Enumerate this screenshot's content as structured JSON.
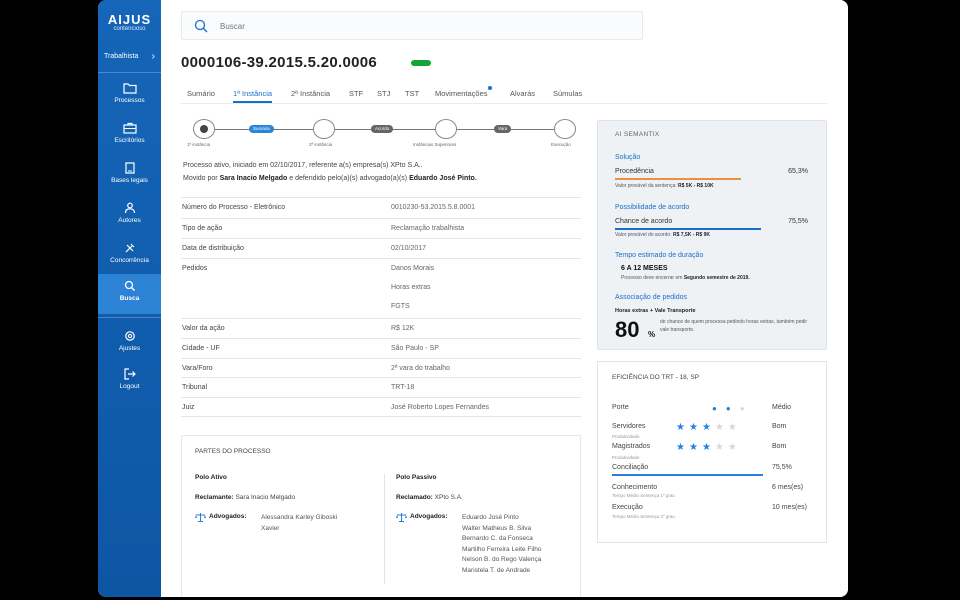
{
  "sidebar": {
    "logo_main": "AIJUS",
    "logo_sub": "contencioso",
    "area_label": "Trabalhista",
    "items": [
      {
        "label": "Processos",
        "icon": "folder-icon"
      },
      {
        "label": "Escritórios",
        "icon": "briefcase-icon"
      },
      {
        "label": "Bases legais",
        "icon": "book-icon"
      },
      {
        "label": "Autores",
        "icon": "users-icon"
      },
      {
        "label": "Concorrência",
        "icon": "tools-icon"
      },
      {
        "label": "Busca",
        "icon": "search-icon",
        "active": true
      },
      {
        "label": "Ajustes",
        "icon": "gear-icon"
      },
      {
        "label": "Logout",
        "icon": "logout-icon"
      }
    ]
  },
  "search": {
    "placeholder": "Buscar"
  },
  "process": {
    "number": "0000106-39.2015.5.20.0006",
    "tabs": [
      "Sumário",
      "1ª Instância",
      "2ª Instância",
      "STF",
      "STJ",
      "TST",
      "Movimentações",
      "Alvarás",
      "Súmulas"
    ],
    "active_tab": "1ª Instância",
    "timeline": {
      "stages": [
        "1ª instância",
        "2ª instância",
        "Instâncias Superiores",
        "Execução"
      ],
      "transitions": [
        "Sumaria",
        "Acordo",
        "Vara"
      ]
    },
    "summary": {
      "line1": "Processo ativo, iniciado em 02/10/2017, referente a(s) empresa(s) XPto S.A..",
      "line2_pre": "Movido por",
      "plaintiff": "Sara Inacio Melgado",
      "line2_mid": "e defendido pelo(a)(s) advogado(a)(s)",
      "defender": "Eduardo José Pinto."
    },
    "details": [
      {
        "label": "Número do Processo - Eletrônico",
        "values": [
          "0010230-53.2015.5.8.0001"
        ]
      },
      {
        "label": "Tipo de ação",
        "values": [
          "Reclamação trabalhista"
        ]
      },
      {
        "label": "Data de distribuição",
        "values": [
          "02/10/2017"
        ]
      },
      {
        "label": "Pedidos",
        "values": [
          "Danos Morais",
          "Horas extras",
          "FGTS"
        ]
      },
      {
        "label": "Valor da ação",
        "values": [
          "R$ 12K"
        ]
      },
      {
        "label": "Cidade - UF",
        "values": [
          "São Paulo - SP"
        ]
      },
      {
        "label": "Vara/Foro",
        "values": [
          "2ª vara do trabalho"
        ]
      },
      {
        "label": "Tribunal",
        "values": [
          "TRT-18"
        ]
      },
      {
        "label": "Juiz",
        "values": [
          "José Roberto Lopes Fernandes"
        ]
      }
    ]
  },
  "partes": {
    "title": "PARTES DO PROCESSO",
    "ativo": {
      "heading": "Polo Ativo",
      "party_label": "Reclamante:",
      "party": "Sara Inacio Melgado",
      "adv_label": "Advogados:",
      "advogados": [
        "Alessandra Karley Giboski",
        "Xavier"
      ]
    },
    "passivo": {
      "heading": "Polo Passivo",
      "party_label": "Reclamado:",
      "party": "XPto S.A.",
      "adv_label": "Advogados:",
      "advogados": [
        "Eduardo José Pinto",
        "Walter Matheus B. Silva",
        "Bernardo C. da Fonseca",
        "Martilho Ferreira Leite Filho",
        "Nelson B. do Rego Valença",
        "Maristela T. de Andrade"
      ]
    }
  },
  "semantix": {
    "title": "AI SEMANTIX",
    "solucao": {
      "heading": "Solução",
      "label": "Procedência",
      "value": "65,3%",
      "fraction": 0.653,
      "sub_pre": "Valor provável da sentença:",
      "sub_val": "R$ 5K - R$ 10K"
    },
    "acordo": {
      "heading": "Possibilidade de acordo",
      "label": "Chance de acordo",
      "value": "75,5%",
      "fraction": 0.755,
      "sub_pre": "Valor provável do acordo:",
      "sub_val": "R$ 7,5K - R$ 9K"
    },
    "duracao": {
      "heading": "Tempo estimado de duração",
      "value": "6 A 12 MESES",
      "sub_pre": "Processo deve encerrar em",
      "sub_val": "Segundo semestre de 2019."
    },
    "associacao": {
      "heading": "Associação de pedidos",
      "label": "Horas extras + Vale Transporte",
      "big": "80",
      "pct": "%",
      "text": "de chance de quem processa pedindo horas extras, também pedir vale transporte."
    },
    "colors": {
      "accent": "#1a6fc9",
      "procedencia_bar": "#e8923c",
      "acordo_bar": "#1a6fc9"
    }
  },
  "eficiencia": {
    "title": "EFICIÊNCIA DO TRT - 18, SP",
    "porte": {
      "label": "Porte",
      "level": 2,
      "max": 3,
      "value": "Médio"
    },
    "servidores": {
      "label": "Servidores",
      "stars": 3,
      "max": 5,
      "value": "Bom",
      "sub": "Produtividade"
    },
    "magistrados": {
      "label": "Magistrados",
      "stars": 3,
      "max": 5,
      "value": "Bom",
      "sub": "Produtividade"
    },
    "conciliacao": {
      "label": "Conciliação",
      "value": "75,5%",
      "fraction": 0.755
    },
    "conhecimento": {
      "label": "Conhecimento",
      "value": "6 mes(es)",
      "sub": "Tempo Médio Sentença 1º grau"
    },
    "execucao": {
      "label": "Execução",
      "value": "10 mes(es)",
      "sub": "Tempo Médio Sentença 2º grau"
    }
  }
}
